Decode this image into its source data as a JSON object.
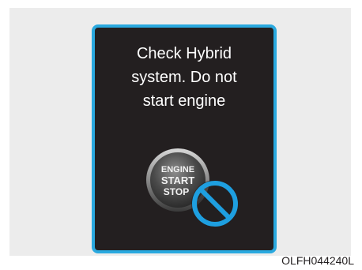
{
  "message": {
    "lines": [
      "Check Hybrid",
      "system. Do not",
      "start engine"
    ]
  },
  "engine_button": {
    "line1": "ENGINE",
    "line2": "START",
    "line3": "STOP"
  },
  "prohibition_icon": "no-symbol-icon",
  "figure_code": "OLFH044240L",
  "colors": {
    "display_background": "#231f20",
    "display_border": "#2aa9df",
    "prohibition": "#1e9fe0",
    "text": "#ffffff"
  }
}
